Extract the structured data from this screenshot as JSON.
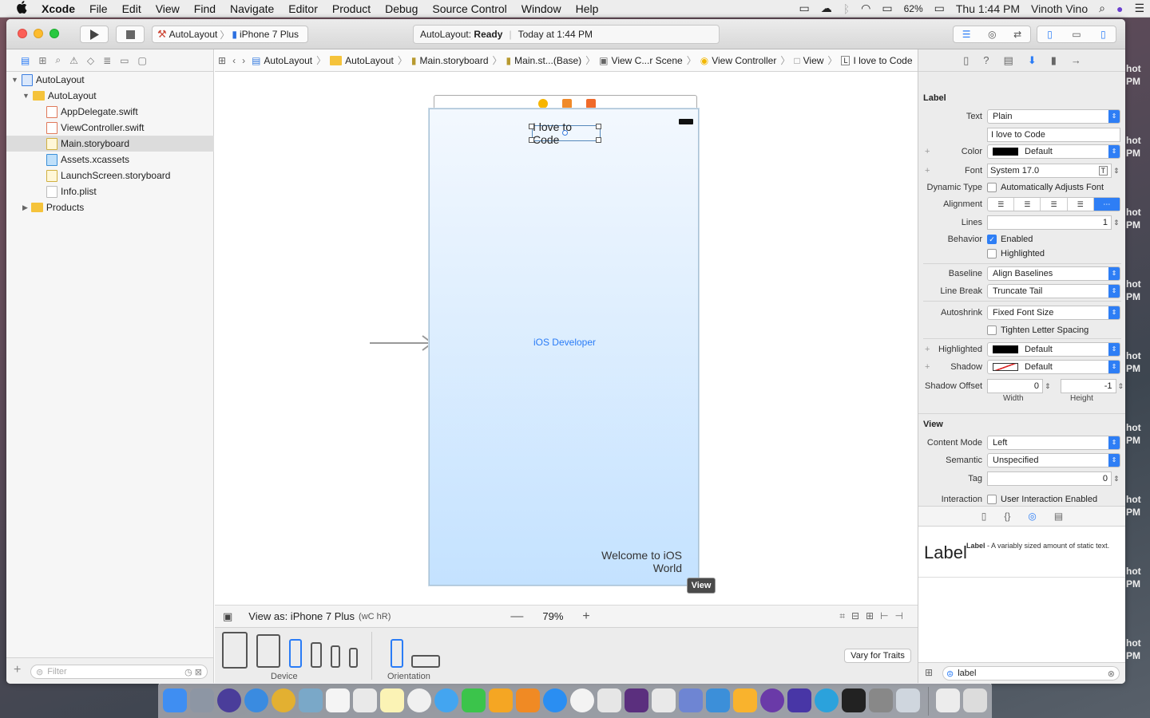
{
  "menubar": {
    "apple": "",
    "app": "Xcode",
    "items": [
      "File",
      "Edit",
      "View",
      "Find",
      "Navigate",
      "Editor",
      "Product",
      "Debug",
      "Source Control",
      "Window",
      "Help"
    ],
    "battery": "62%",
    "clock": "Thu 1:44 PM",
    "user": "Vinoth Vino"
  },
  "desktop": {
    "shot_label": "hot",
    "pm_label": "PM"
  },
  "toolbar": {
    "scheme": "AutoLayout",
    "device": "iPhone 7 Plus",
    "status_project": "AutoLayout:",
    "status_state": "Ready",
    "status_time": "Today at 1:44 PM"
  },
  "navigator": {
    "project": "AutoLayout",
    "group": "AutoLayout",
    "files": [
      "AppDelegate.swift",
      "ViewController.swift",
      "Main.storyboard",
      "Assets.xcassets",
      "LaunchScreen.storyboard",
      "Info.plist"
    ],
    "products": "Products",
    "filter_placeholder": "Filter"
  },
  "jumpbar": {
    "crumbs": [
      "AutoLayout",
      "AutoLayout",
      "Main.storyboard",
      "Main.st...(Base)",
      "View C...r Scene",
      "View Controller",
      "View",
      "L",
      "I love to Code"
    ]
  },
  "canvas": {
    "label_top": "I love to Code",
    "label_center": "iOS Developer",
    "label_bottom": "Welcome to iOS World",
    "view_tag": "View"
  },
  "bottombar": {
    "view_as": "View as: iPhone 7 Plus",
    "size_class": "(wC hR)",
    "zoom": "79%"
  },
  "devicebar": {
    "device_label": "Device",
    "orientation_label": "Orientation",
    "vary_button": "Vary for Traits"
  },
  "inspector": {
    "label_section": "Label",
    "text_label": "Text",
    "text_type": "Plain",
    "text_value": "I love to Code",
    "color_label": "Color",
    "color_value": "Default",
    "font_label": "Font",
    "font_value": "System 17.0",
    "dynamic_label": "Dynamic Type",
    "dynamic_value": "Automatically Adjusts Font",
    "alignment_label": "Alignment",
    "lines_label": "Lines",
    "lines_value": "1",
    "behavior_label": "Behavior",
    "enabled": "Enabled",
    "highlighted": "Highlighted",
    "baseline_label": "Baseline",
    "baseline_value": "Align Baselines",
    "linebreak_label": "Line Break",
    "linebreak_value": "Truncate Tail",
    "autoshrink_label": "Autoshrink",
    "autoshrink_value": "Fixed Font Size",
    "tighten": "Tighten Letter Spacing",
    "hl_label": "Highlighted",
    "hl_value": "Default",
    "shadow_label": "Shadow",
    "shadow_value": "Default",
    "offset_label": "Shadow Offset",
    "offset_w": "0",
    "offset_h": "-1",
    "width_caption": "Width",
    "height_caption": "Height",
    "view_section": "View",
    "content_mode_label": "Content Mode",
    "content_mode_value": "Left",
    "semantic_label": "Semantic",
    "semantic_value": "Unspecified",
    "tag_label": "Tag",
    "tag_value": "0",
    "interaction_label": "Interaction",
    "interaction_value": "User Interaction Enabled",
    "library_title": "Label",
    "library_name": "Label",
    "library_desc": "- A variably sized amount of static text.",
    "search_value": "label"
  }
}
